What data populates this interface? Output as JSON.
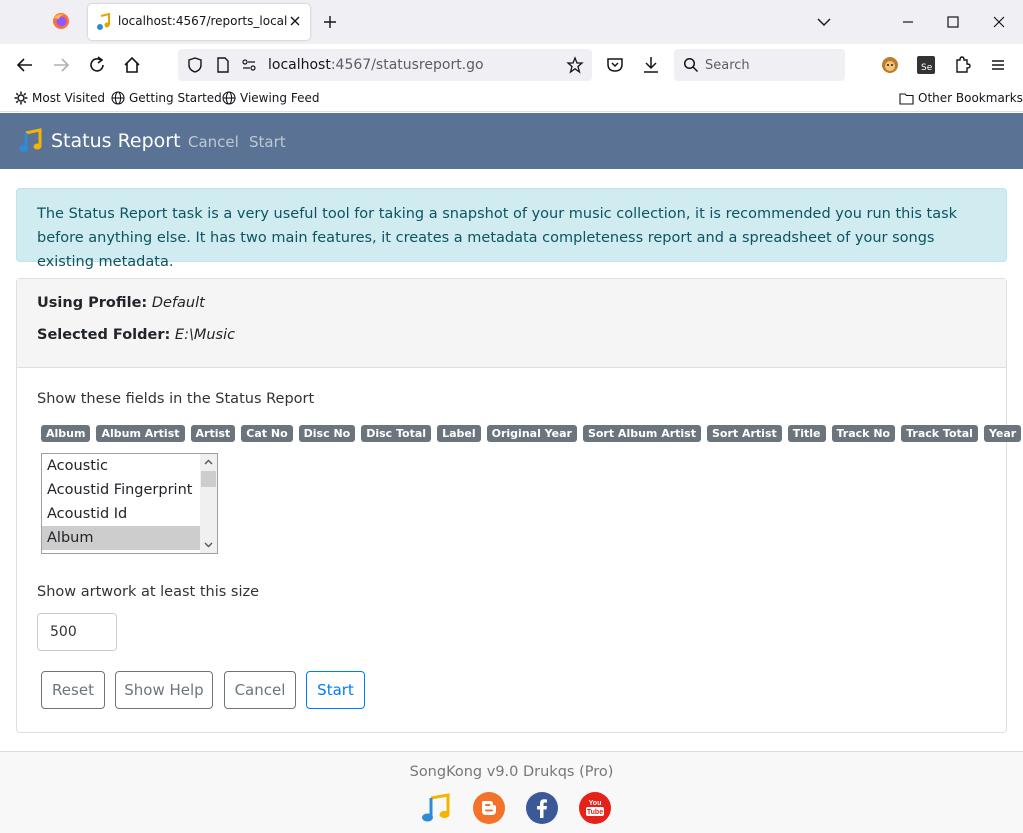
{
  "browser": {
    "tab_title": "localhost:4567/reports_local",
    "url_host": "localhost",
    "url_rest": ":4567/statusreport.go",
    "search_placeholder": "Search",
    "bookmarks": [
      "Most Visited",
      "Getting Started",
      "Viewing Feed"
    ],
    "other_bookmarks": "Other Bookmarks"
  },
  "navbar": {
    "brand": "Status Report",
    "links": [
      "Cancel",
      "Start"
    ]
  },
  "alert": {
    "text": "The Status Report task is a very useful tool for taking a snapshot of your music collection, it is recommended you run this task before anything else. It has two main features, it creates a metadata completeness report and a spreadsheet of your songs existing metadata."
  },
  "profile": {
    "profile_label": "Using Profile:",
    "profile_value": "Default",
    "folder_label": "Selected Folder:",
    "folder_value": "E:\\Music"
  },
  "fields": {
    "label": "Show these fields in the Status Report",
    "tags": [
      "Album",
      "Album Artist",
      "Artist",
      "Cat No",
      "Disc No",
      "Disc Total",
      "Label",
      "Original Year",
      "Sort Album Artist",
      "Sort Artist",
      "Title",
      "Track No",
      "Track Total",
      "Year"
    ],
    "options": [
      "Acoustic",
      "Acoustid Fingerprint",
      "Acoustid Id",
      "Album"
    ],
    "selected_option": "Album"
  },
  "artwork": {
    "label": "Show artwork at least this size",
    "value": "500"
  },
  "buttons": {
    "reset": "Reset",
    "help": "Show Help",
    "cancel": "Cancel",
    "start": "Start"
  },
  "footer": {
    "text": "SongKong v9.0 Drukqs (Pro)",
    "icons": [
      "songkong-icon",
      "blogger-icon",
      "facebook-icon",
      "youtube-icon"
    ]
  },
  "colors": {
    "navbar": "#5a7394",
    "alert_bg": "#d1ecf1",
    "tag_bg": "#6c757d",
    "primary": "#007bff"
  }
}
